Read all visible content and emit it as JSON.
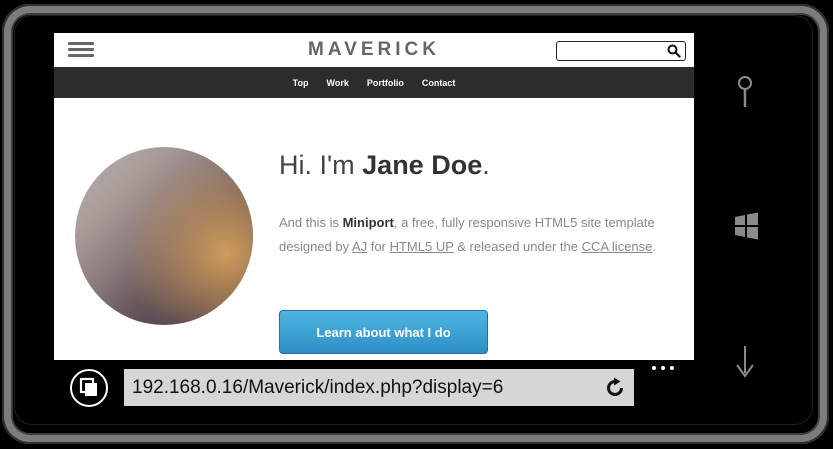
{
  "site": {
    "brand": "MAVERICK",
    "search_placeholder": ""
  },
  "nav": {
    "items": [
      {
        "label": "Top"
      },
      {
        "label": "Work"
      },
      {
        "label": "Portfolio"
      },
      {
        "label": "Contact"
      }
    ]
  },
  "hero": {
    "greeting_prefix": "Hi. I'm ",
    "name": "Jane Doe",
    "greeting_suffix": ".",
    "intro": {
      "part1": "And this is ",
      "product": "Miniport",
      "part2": ", a free, fully responsive HTML5 site template designed by ",
      "link_author": "AJ",
      "part3": " for ",
      "link_site": "HTML5 UP",
      "part4": " & released under the ",
      "link_license": "CCA license",
      "part5": "."
    },
    "cta_label": "Learn about what I do"
  },
  "browser": {
    "url": "192.168.0.16/Maverick/index.php?display=6"
  },
  "hardware_buttons": [
    "search-icon",
    "windows-start-icon",
    "back-arrow-icon"
  ],
  "colors": {
    "nav_bg": "#2c2c2c",
    "cta_bg": "#3a9fd4",
    "url_bar_bg": "#d6d6d6"
  }
}
